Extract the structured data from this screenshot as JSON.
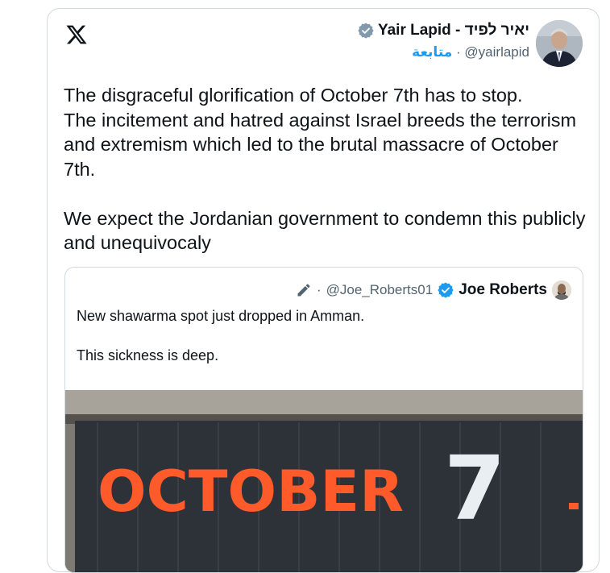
{
  "post": {
    "author_name": "Yair Lapid - יאיר לפיד",
    "author_handle": "@yairlapid",
    "follow_label": "متابعة",
    "separator": "·",
    "text": "The disgraceful glorification of October 7th has to stop.\nThe incitement and hatred against Israel breeds the terrorism and extremism which led to the brutal massacre of October 7th.\n\nWe expect the Jordanian government to condemn this publicly and unequivocaly"
  },
  "quoted_post": {
    "author_name": "Joe Roberts",
    "author_handle": "@Joe_Roberts01",
    "separator": "·",
    "text": "New shawarma spot just dropped in Amman.\n\nThis sickness is deep.",
    "media": {
      "sign_word": "OCTOBER",
      "sign_number": "7",
      "sign_letter_color": "#ff5a2a",
      "sign_bg_color": "#2d3138",
      "number_color": "#e9eef2"
    }
  },
  "icons": {
    "logo": "x-logo-icon",
    "gray_verified": "gray-verified-badge-icon",
    "blue_verified": "blue-verified-badge-icon",
    "edit": "pencil-edit-icon"
  },
  "colors": {
    "accent": "#1d9bf0",
    "border": "#cfd9de",
    "secondary_text": "#536471"
  }
}
